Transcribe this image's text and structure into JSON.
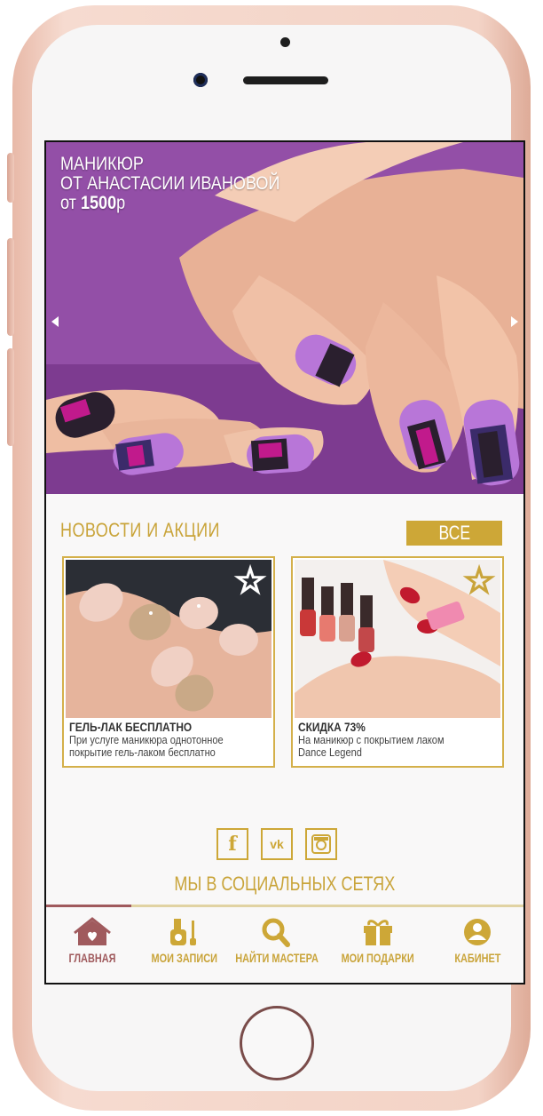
{
  "banner": {
    "line1": "МАНИКЮР",
    "line2": "ОТ АНАСТАСИИ ИВАНОВОЙ",
    "price_prefix": "от",
    "price_value": "1500",
    "price_suffix": "р"
  },
  "news": {
    "title": "НОВОСТИ И АКЦИИ",
    "all_label": "ВСЕ",
    "cards": [
      {
        "title": "ГЕЛЬ-ЛАК БЕСПЛАТНО",
        "line1": "При услуге маникюра однотонное",
        "line2": "покрытие гель-лаком бесплатно",
        "star": "outline-white"
      },
      {
        "title": "СКИДКА 73%",
        "line1": "На маникюр с покрытием лаком",
        "line2": "Dance Legend",
        "star": "outline-gold"
      }
    ]
  },
  "social": {
    "label": "МЫ В СОЦИАЛЬНЫХ СЕТЯХ",
    "icons": [
      "facebook-icon",
      "vk-icon",
      "instagram-icon"
    ],
    "fb_glyph": "f",
    "vk_glyph": "vk"
  },
  "tabs": [
    {
      "label": "ГЛАВНАЯ",
      "icon": "home-icon",
      "active": true
    },
    {
      "label": "МОИ ЗАПИСИ",
      "icon": "nail-polish-icon",
      "active": false
    },
    {
      "label": "НАЙТИ МАСТЕРА",
      "icon": "search-icon",
      "active": false
    },
    {
      "label": "МОИ ПОДАРКИ",
      "icon": "gift-icon",
      "active": false
    },
    {
      "label": "КАБИНЕТ",
      "icon": "user-icon",
      "active": false
    }
  ],
  "colors": {
    "gold": "#cda737",
    "active_tab": "#a05a5d",
    "banner_purple": "#8c49a0"
  }
}
